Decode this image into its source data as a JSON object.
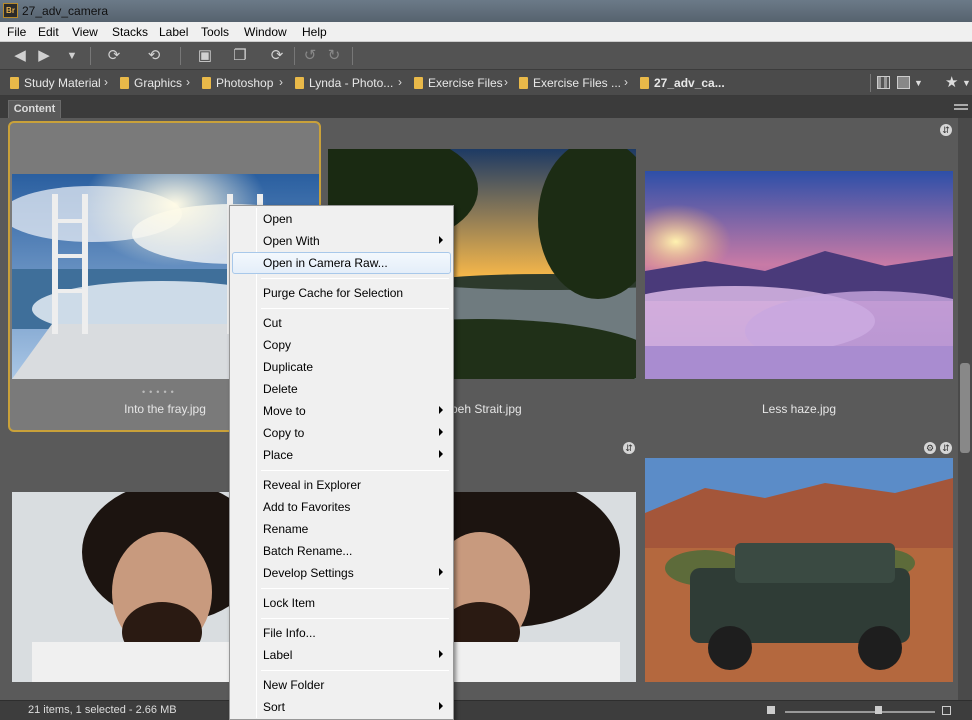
{
  "window": {
    "title": "27_adv_camera",
    "app_icon": "Br"
  },
  "menubar": [
    "File",
    "Edit",
    "View",
    "Stacks",
    "Label",
    "Tools",
    "Window",
    "Help"
  ],
  "path": [
    "Study Material",
    "Graphics",
    "Photoshop",
    "Lynda - Photo...",
    "Exercise Files",
    "Exercise Files ...",
    "27_adv_ca..."
  ],
  "panel": {
    "tab": "Content"
  },
  "thumbnails": [
    {
      "name": "Into the fray.jpg",
      "selected": true
    },
    {
      "name": "Lembeh Strait.jpg",
      "visible_caption": "nbeh Strait.jpg",
      "selected": false
    },
    {
      "name": "Less haze.jpg",
      "selected": false
    }
  ],
  "context_menu": {
    "highlighted": "Open in Camera Raw...",
    "items": [
      {
        "label": "Open"
      },
      {
        "label": "Open With",
        "submenu": true
      },
      {
        "label": "Open in Camera Raw..."
      },
      {
        "label": "Purge Cache for Selection"
      },
      {
        "label": "Cut"
      },
      {
        "label": "Copy"
      },
      {
        "label": "Duplicate"
      },
      {
        "label": "Delete"
      },
      {
        "label": "Move to",
        "submenu": true
      },
      {
        "label": "Copy to",
        "submenu": true
      },
      {
        "label": "Place",
        "submenu": true
      },
      {
        "label": "Reveal in Explorer"
      },
      {
        "label": "Add to Favorites"
      },
      {
        "label": "Rename"
      },
      {
        "label": "Batch Rename..."
      },
      {
        "label": "Develop Settings",
        "submenu": true
      },
      {
        "label": "Lock Item"
      },
      {
        "label": "File Info..."
      },
      {
        "label": "Label",
        "submenu": true
      },
      {
        "label": "New Folder"
      },
      {
        "label": "Sort",
        "submenu": true
      }
    ]
  },
  "status": {
    "text": "21 items, 1 selected - 2.66 MB"
  },
  "colors": {
    "selection_border": "#c9a13a",
    "folder": "#e9b949",
    "menu_highlight": "#e4eef9"
  }
}
